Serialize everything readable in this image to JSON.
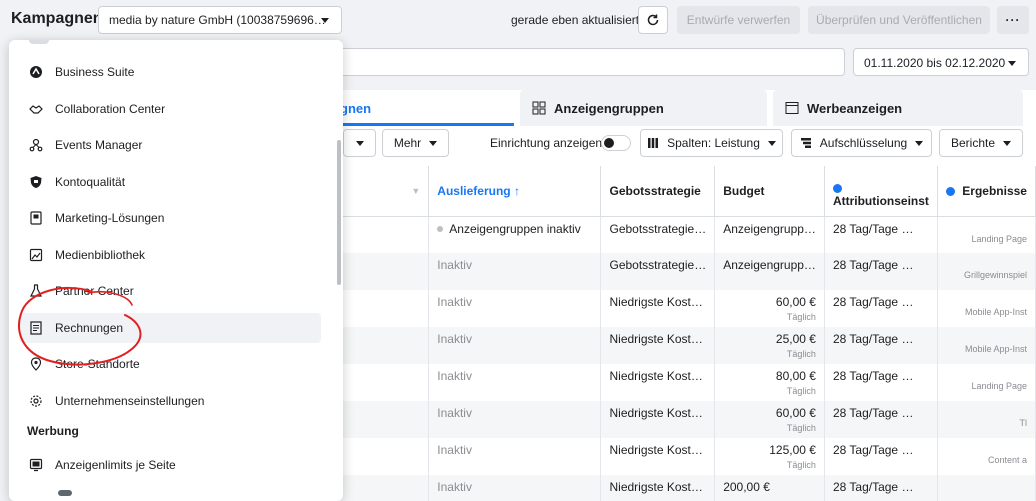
{
  "header": {
    "title": "Kampagnen",
    "account": "media by nature GmbH (10038759696…",
    "status": "gerade eben aktualisiert",
    "discard_label": "Entwürfe verwerfen",
    "review_label": "Überprüfen und Veröffentlichen",
    "more_label": "···"
  },
  "date_range": "01.11.2020 bis 02.12.2020",
  "tabs": [
    {
      "label": "gnen"
    },
    {
      "label": "Anzeigengruppen"
    },
    {
      "label": "Werbeanzeigen"
    }
  ],
  "toolbar": {
    "more_label": "Mehr",
    "setup_label": "Einrichtung anzeigen",
    "columns_label": "Spalten: Leistung",
    "breakdown_label": "Aufschlüsselung",
    "reports_label": "Berichte"
  },
  "table": {
    "headers": [
      "Auslieferung ↑",
      "Gebotsstrategie",
      "Budget",
      "Attributionseinst",
      "Ergebnisse"
    ],
    "rows": [
      {
        "delivery": "Anzeigengruppen inaktiv",
        "bid": "Gebotsstrategie…",
        "budget": "Anzeigengrupp…",
        "budget_sub": "",
        "attr": "28 Tag/Tage …",
        "result": "Landing Page"
      },
      {
        "delivery": "Inaktiv",
        "bid": "Gebotsstrategie…",
        "budget": "Anzeigengrupp…",
        "budget_sub": "",
        "attr": "28 Tag/Tage …",
        "result": "Grillgewinnspiel"
      },
      {
        "delivery": "Inaktiv",
        "bid": "Niedrigste Kost…",
        "budget": "60,00 €",
        "budget_sub": "Täglich",
        "attr": "28 Tag/Tage …",
        "result": "Mobile App-Inst"
      },
      {
        "delivery": "Inaktiv",
        "bid": "Niedrigste Kost…",
        "budget": "25,00 €",
        "budget_sub": "Täglich",
        "attr": "28 Tag/Tage …",
        "result": "Mobile App-Inst"
      },
      {
        "delivery": "Inaktiv",
        "bid": "Niedrigste Kost…",
        "budget": "80,00 €",
        "budget_sub": "Täglich",
        "attr": "28 Tag/Tage …",
        "result": "Landing Page"
      },
      {
        "delivery": "Inaktiv",
        "bid": "Niedrigste Kost…",
        "budget": "60,00 €",
        "budget_sub": "Täglich",
        "attr": "28 Tag/Tage …",
        "result": "Tl"
      },
      {
        "delivery": "Inaktiv",
        "bid": "Niedrigste Kost…",
        "budget": "125,00 €",
        "budget_sub": "Täglich",
        "attr": "28 Tag/Tage …",
        "result": "Content a"
      },
      {
        "delivery": "Inaktiv",
        "bid": "Niedrigste Kost…",
        "budget": "200,00 €",
        "budget_sub": "",
        "attr": "28 Tag/Tage …",
        "result": ""
      }
    ]
  },
  "menu": {
    "items": [
      {
        "label": "Business Suite",
        "icon": "business-suite-icon"
      },
      {
        "label": "Collaboration Center",
        "icon": "handshake-icon"
      },
      {
        "label": "Events Manager",
        "icon": "people-network-icon"
      },
      {
        "label": "Kontoqualität",
        "icon": "shield-icon"
      },
      {
        "label": "Marketing-Lösungen",
        "icon": "book-icon"
      },
      {
        "label": "Medienbibliothek",
        "icon": "media-library-icon"
      },
      {
        "label": "Partner Center",
        "icon": "flask-icon"
      },
      {
        "label": "Rechnungen",
        "icon": "invoice-icon"
      },
      {
        "label": "Store-Standorte",
        "icon": "location-icon"
      },
      {
        "label": "Unternehmenseinstellungen",
        "icon": "gear-icon"
      }
    ],
    "section": "Werbung",
    "section_items": [
      {
        "label": "Anzeigenlimits je Seite",
        "icon": "monitor-icon"
      }
    ]
  },
  "colors": {
    "accent": "#1877f2",
    "annotation": "#e02020"
  }
}
